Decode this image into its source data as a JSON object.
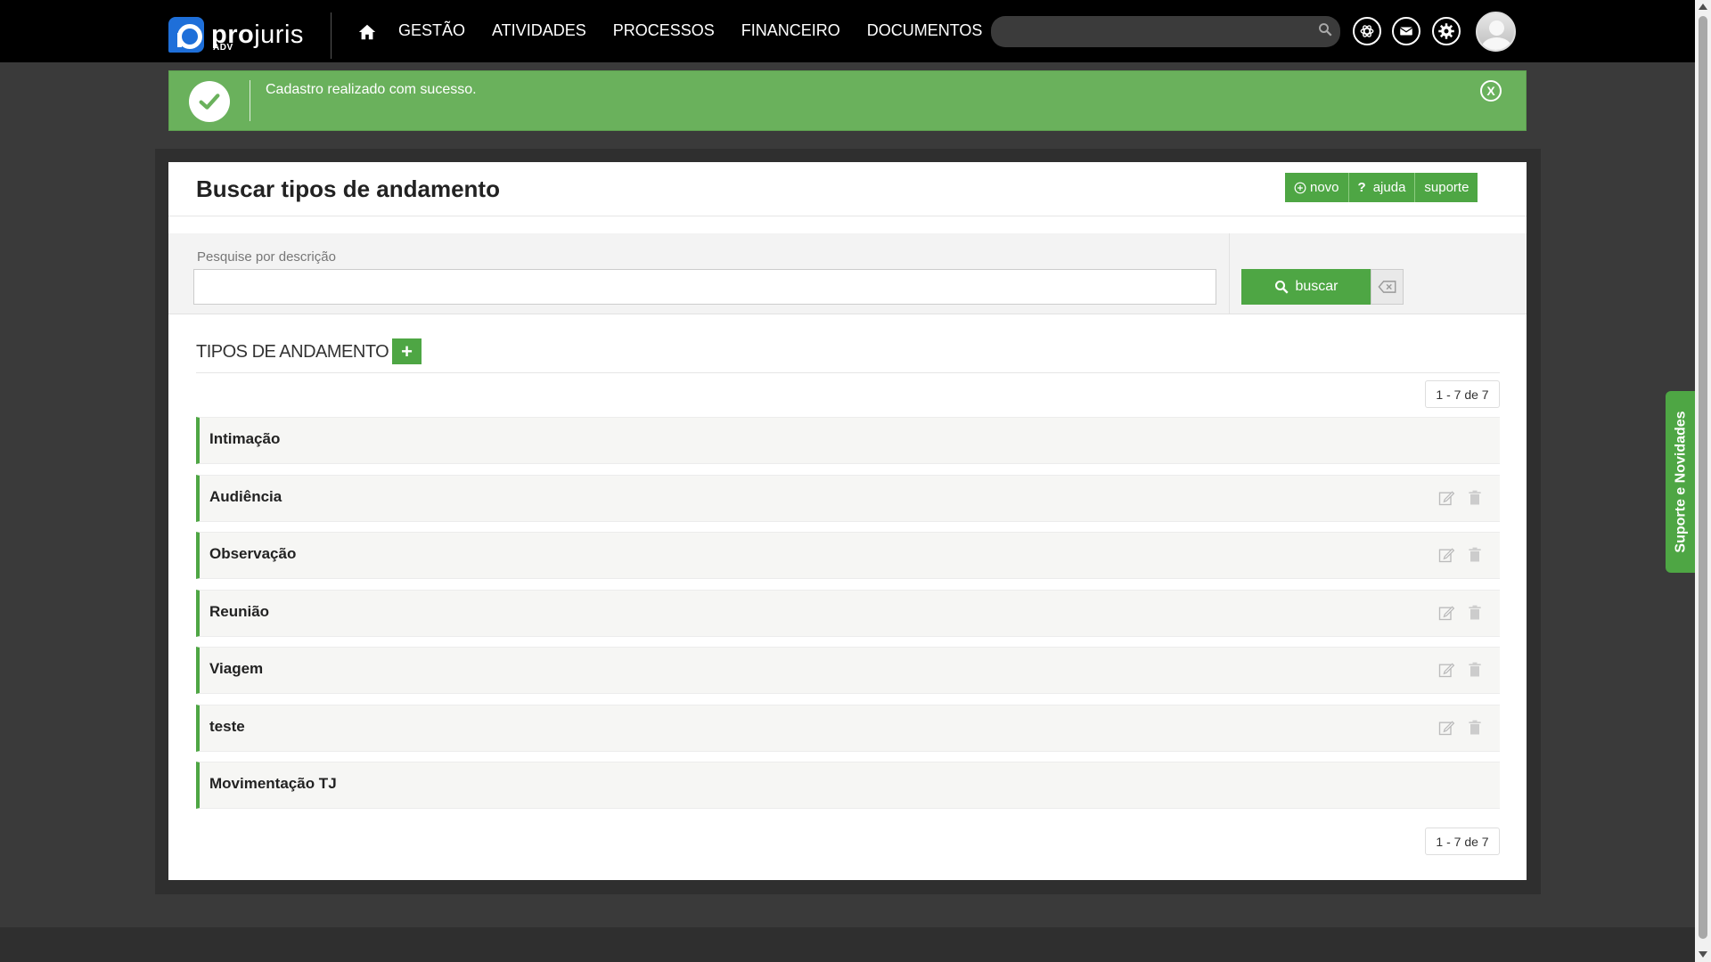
{
  "brand": {
    "name_bold": "pro",
    "name_light": "juris",
    "sub": "ADV"
  },
  "nav": {
    "items": [
      {
        "label": "GESTÃO"
      },
      {
        "label": "ATIVIDADES"
      },
      {
        "label": "PROCESSOS"
      },
      {
        "label": "FINANCEIRO"
      },
      {
        "label": "DOCUMENTOS"
      }
    ],
    "search": {
      "placeholder": "",
      "value": ""
    }
  },
  "banner": {
    "message": "Cadastro realizado com sucesso.",
    "close_label": "X"
  },
  "page": {
    "title": "Buscar tipos de andamento",
    "actions": {
      "novo": "novo",
      "ajuda": "ajuda",
      "suporte": "suporte"
    }
  },
  "filter": {
    "label": "Pesquise por descrição",
    "value": "",
    "search_button": "buscar"
  },
  "list": {
    "section_title": "TIPOS DE ANDAMENTO",
    "add_label": "+",
    "pagination_top": "1 - 7 de 7",
    "pagination_bottom": "1 - 7 de 7",
    "items": [
      {
        "label": "Intimação",
        "editable": false
      },
      {
        "label": "Audiência",
        "editable": true
      },
      {
        "label": "Observação",
        "editable": true
      },
      {
        "label": "Reunião",
        "editable": true
      },
      {
        "label": "Viagem",
        "editable": true
      },
      {
        "label": "teste",
        "editable": true
      },
      {
        "label": "Movimentação TJ",
        "editable": false
      }
    ]
  },
  "side_tab": {
    "label": "Suporte e Novidades"
  },
  "colors": {
    "accent": "#4ea644",
    "banner": "#6ab15c",
    "topbar": "#000000"
  }
}
